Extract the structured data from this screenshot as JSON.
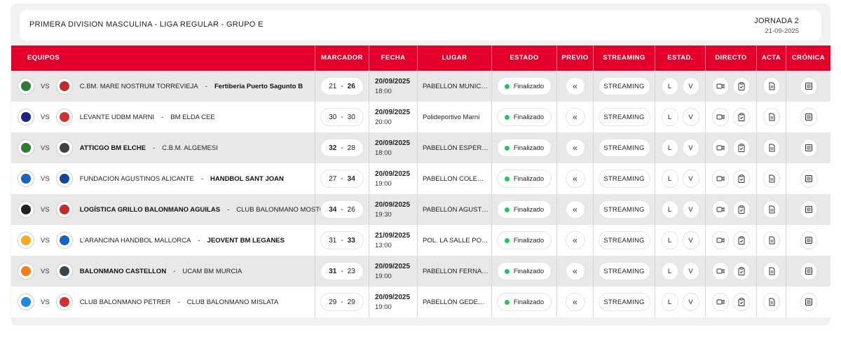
{
  "header": {
    "competition": "PRIMERA DIVISION MASCULINA - LIGA REGULAR - GRUPO E",
    "jornada_label": "JORNADA 2",
    "jornada_date": "21-09-2025"
  },
  "columns": {
    "equipos": "EQUIPOS",
    "marcador": "MARCADOR",
    "fecha": "FECHA",
    "lugar": "LUGAR",
    "estado": "ESTADO",
    "previo": "PREVIO",
    "streaming": "STREAMING",
    "estad": "ESTAD.",
    "directo": "DIRECTO",
    "acta": "ACTA",
    "cronica": "CRÓNICA"
  },
  "labels": {
    "vs": "VS",
    "dash": "-",
    "streaming_btn": "STREAMING",
    "local": "L",
    "visitante": "V",
    "previo_symbol": "«"
  },
  "colors": {
    "accent": "#e4002b",
    "status_finished": "#22c55e"
  },
  "icons": {
    "directo_video": "video-camera-icon",
    "directo_clipboard": "clipboard-icon",
    "acta": "document-icon",
    "cronica": "newspaper-icon"
  },
  "matches": [
    {
      "home": "C.BM. MARE NOSTRUM TORREVIEJA",
      "away": "Fertiberia Puerto Sagunto B",
      "home_score": "21",
      "away_score": "26",
      "winner": "away",
      "date": "20/09/2025",
      "time": "18:00",
      "venue": "PABELLON MUNICIPAL DE DEPORTES",
      "status": "Finalizado",
      "home_color": "#2e7d32",
      "away_color": "#c62828"
    },
    {
      "home": "LEVANTE UDBM MARNI",
      "away": "BM ELDA CEE",
      "home_score": "30",
      "away_score": "30",
      "winner": "none",
      "date": "20/09/2025",
      "time": "20:00",
      "venue": "Polideportivo Marni",
      "status": "Finalizado",
      "home_color": "#1a237e",
      "away_color": "#d32f2f"
    },
    {
      "home": "ATTICGO BM ELCHE",
      "away": "C.B.M. ALGEMESI",
      "home_score": "32",
      "away_score": "28",
      "winner": "home",
      "date": "20/09/2025",
      "time": "18:00",
      "venue": "PABELLÓN ESPERANZA LAG",
      "status": "Finalizado",
      "home_color": "#2e7d32",
      "away_color": "#424242"
    },
    {
      "home": "FUNDACION AGUSTINOS ALICANTE",
      "away": "HANDBOL SANT JOAN",
      "home_score": "27",
      "away_score": "34",
      "winner": "away",
      "date": "20/09/2025",
      "time": "19:00",
      "venue": "PABELLON COLEGIO AGUSTINOS",
      "status": "Finalizado",
      "home_color": "#1565c0",
      "away_color": "#0d47a1"
    },
    {
      "home": "LOGÍSTICA GRILLO BALONMANO AGUILAS",
      "away": "CLUB BALONMANO MOSTOLES",
      "home_score": "34",
      "away_score": "26",
      "winner": "home",
      "date": "20/09/2025",
      "time": "19:30",
      "venue": "PABELLÓN AGUSTÍN GARCÍA",
      "status": "Finalizado",
      "home_color": "#212121",
      "away_color": "#c62828"
    },
    {
      "home": "L'ARANCINA HANDBOL MALLORCA",
      "away": "JEOVENT BM LEGANES",
      "home_score": "31",
      "away_score": "33",
      "winner": "away",
      "date": "21/09/2025",
      "time": "13:00",
      "venue": "POL. LA SALLE PONTS",
      "status": "Finalizado",
      "home_color": "#f9a825",
      "away_color": "#1565c0"
    },
    {
      "home": "BALONMANO CASTELLON",
      "away": "UCAM BM MURCIA",
      "home_score": "31",
      "away_score": "23",
      "winner": "home",
      "date": "20/09/2025",
      "time": "19:00",
      "venue": "PABELLON FERNANDO ESCOBAR",
      "status": "Finalizado",
      "home_color": "#f57f17",
      "away_color": "#37474f"
    },
    {
      "home": "CLUB BALONMANO PETRER",
      "away": "CLUB BALONMANO MISLATA",
      "home_score": "29",
      "away_score": "29",
      "winner": "none",
      "date": "20/09/2025",
      "time": "19:00",
      "venue": "PABELLÓN GEDEON MUNICIPAL",
      "status": "Finalizado",
      "home_color": "#1e88e5",
      "away_color": "#d32f2f"
    }
  ]
}
